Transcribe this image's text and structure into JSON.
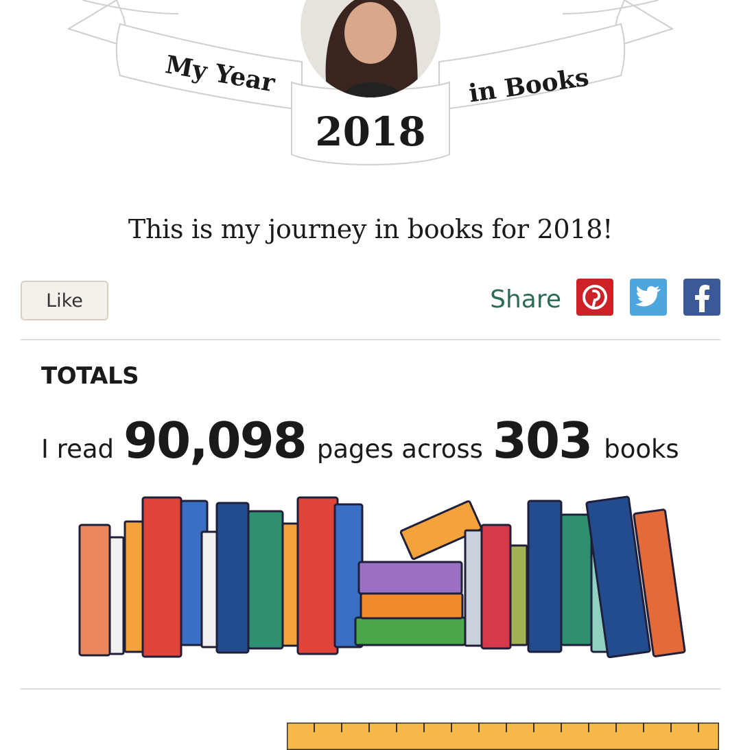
{
  "header": {
    "banner_left": "My Year",
    "banner_right": "in Books",
    "year": "2018"
  },
  "intro": "This is my journey in books for 2018!",
  "actions": {
    "like_label": "Like",
    "share_label": "Share",
    "share_targets": [
      "pinterest-icon",
      "twitter-icon",
      "facebook-icon"
    ]
  },
  "totals": {
    "heading": "TOTALS",
    "prefix": "I read",
    "pages": "90,098",
    "middle": "pages across",
    "books": "303",
    "suffix": "books"
  },
  "colors": {
    "share_text": "#2d6b58",
    "pinterest": "#cc2127",
    "twitter": "#4da7de",
    "facebook": "#3b5998",
    "like_bg": "#f4f1ea"
  }
}
